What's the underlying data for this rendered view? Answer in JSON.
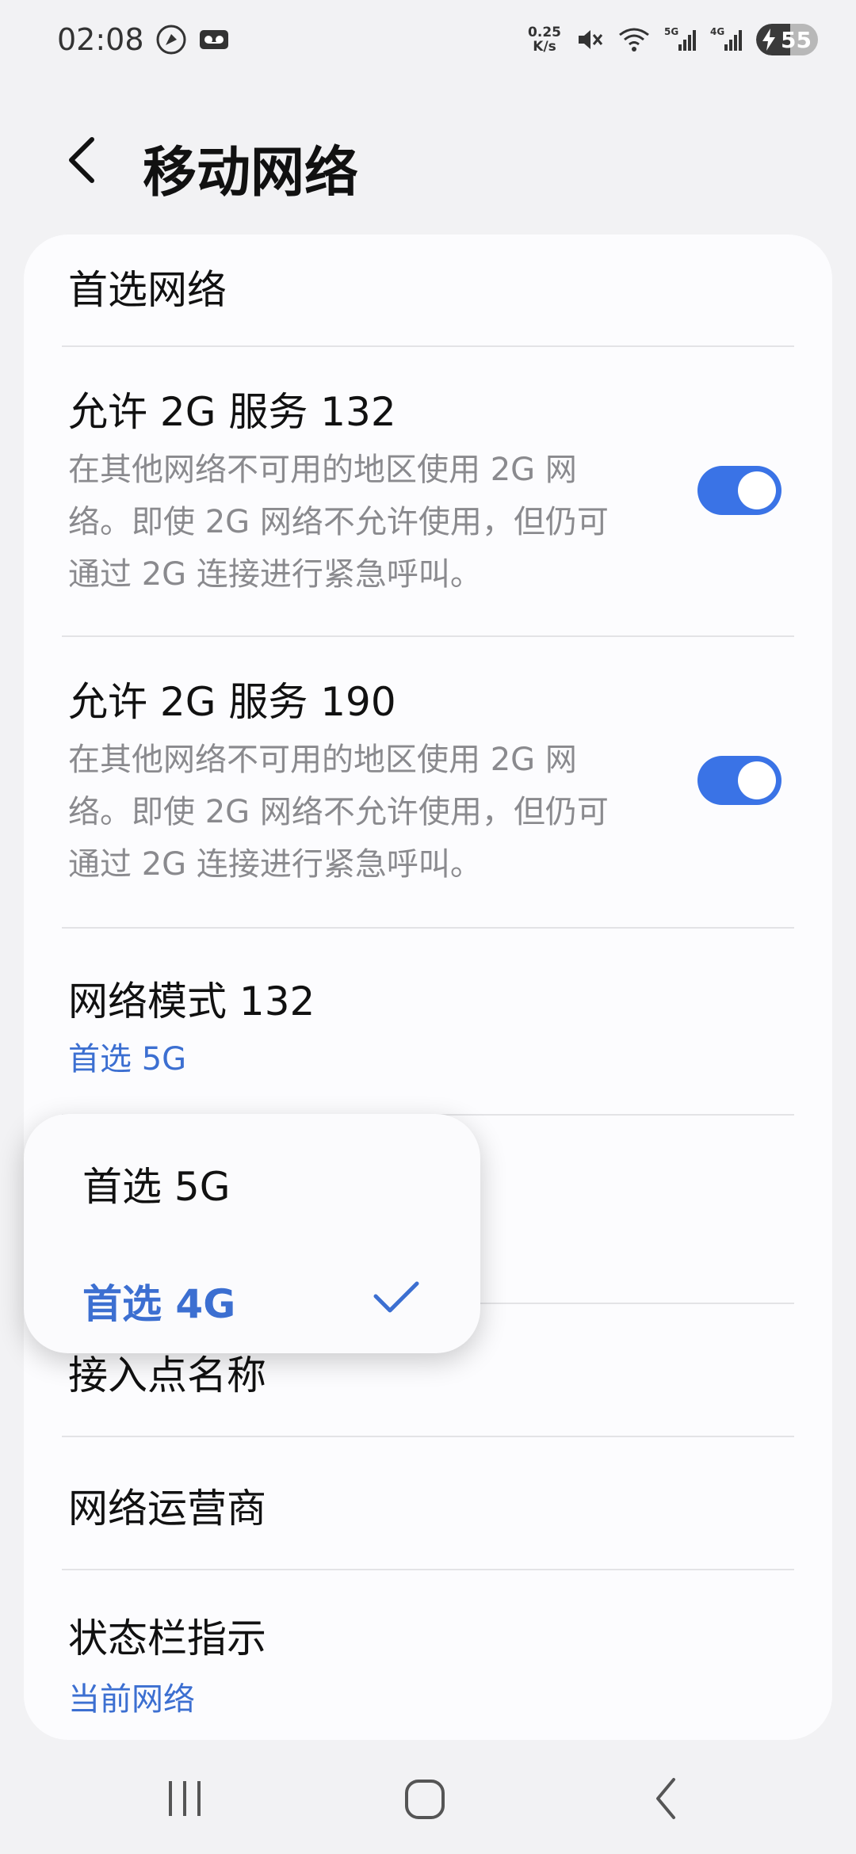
{
  "status_bar": {
    "time": "02:08",
    "speed_value": "0.25",
    "speed_unit": "K/s",
    "battery_level": "55",
    "icons": [
      "rocket-icon",
      "voicemail-icon",
      "mute-icon",
      "wifi-icon",
      "signal-5g-icon",
      "signal-4g-icon",
      "battery-charging-icon"
    ]
  },
  "header": {
    "title": "移动网络"
  },
  "settings": {
    "preferred_network": {
      "title": "首选网络"
    },
    "allow_2g_132": {
      "title": "允许 2G 服务 132",
      "description": "在其他网络不可用的地区使用 2G 网络。即使 2G 网络不允许使用，但仍可通过 2G 连接进行紧急呼叫。",
      "desc_line1": "在其他网络不可用的地区使用 2G 网",
      "desc_line2": "络。即使 2G 网络不允许使用，但仍可",
      "desc_line3": "通过 2G 连接进行紧急呼叫。",
      "enabled": true
    },
    "allow_2g_190": {
      "title": "允许 2G 服务 190",
      "desc_line1": "在其他网络不可用的地区使用 2G 网",
      "desc_line2": "络。即使 2G 网络不允许使用，但仍可",
      "desc_line3": "通过 2G 连接进行紧急呼叫。",
      "enabled": true
    },
    "network_mode_132": {
      "title": "网络模式 132",
      "value": "首选 5G"
    },
    "apn": {
      "title": "接入点名称"
    },
    "network_operator": {
      "title": "网络运营商"
    },
    "status_bar_indicator": {
      "title": "状态栏指示",
      "value": "当前网络"
    }
  },
  "popup": {
    "options": [
      {
        "label": "首选 5G",
        "selected": false
      },
      {
        "label": "首选 4G",
        "selected": true
      }
    ]
  },
  "colors": {
    "accent": "#3a73e6",
    "link": "#3c6fd1",
    "background": "#f2f2f4",
    "card": "#fcfcfe"
  }
}
